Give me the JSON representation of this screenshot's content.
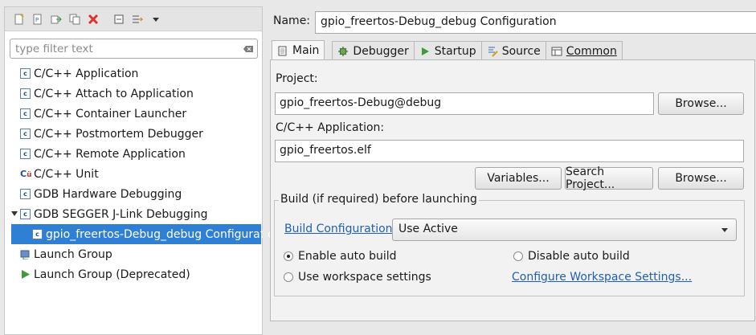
{
  "toolbar": {
    "icons": [
      "new-configuration-icon",
      "new-prototype-icon",
      "export-icon",
      "duplicate-icon",
      "delete-icon",
      "collapse-all-icon",
      "filter-icon",
      "view-menu-icon"
    ]
  },
  "filter": {
    "placeholder": "type filter text",
    "value": ""
  },
  "tree": {
    "items": [
      {
        "label": "C/C++ Application",
        "icon": "c-launch-icon"
      },
      {
        "label": "C/C++ Attach to Application",
        "icon": "c-launch-icon"
      },
      {
        "label": "C/C++ Container Launcher",
        "icon": "c-launch-icon"
      },
      {
        "label": "C/C++ Postmortem Debugger",
        "icon": "c-launch-icon"
      },
      {
        "label": "C/C++ Remote Application",
        "icon": "c-launch-icon"
      },
      {
        "label": "C/C++ Unit",
        "icon": "c-unit-icon"
      },
      {
        "label": "GDB Hardware Debugging",
        "icon": "c-launch-icon"
      },
      {
        "label": "GDB SEGGER J-Link Debugging",
        "icon": "c-launch-icon",
        "expanded": true
      },
      {
        "label": "gpio_freertos-Debug_debug Configuration",
        "icon": "c-launch-icon",
        "selected": true
      },
      {
        "label": "Launch Group",
        "icon": "launch-group-icon"
      },
      {
        "label": "Launch Group (Deprecated)",
        "icon": "run-icon"
      }
    ]
  },
  "config": {
    "name_label": "Name:",
    "name_value": "gpio_freertos-Debug_debug Configuration"
  },
  "tabs": [
    {
      "label": "Main",
      "icon": "main-tab-icon",
      "active": true
    },
    {
      "label": "Debugger",
      "icon": "debugger-tab-icon"
    },
    {
      "label": "Startup",
      "icon": "startup-tab-icon"
    },
    {
      "label": "Source",
      "icon": "source-tab-icon"
    },
    {
      "label": "Common",
      "icon": "common-tab-icon"
    }
  ],
  "main": {
    "project_label": "Project:",
    "project_value": "gpio_freertos-Debug@debug",
    "browse_label": "Browse...",
    "app_label": "C/C++ Application:",
    "app_value": "gpio_freertos.elf",
    "variables_label": "Variables...",
    "search_project_label": "Search Project...",
    "browse2_label": "Browse...",
    "build_group_title": "Build (if required) before launching",
    "build_config_link": "Build Configuration:",
    "build_config_value": "Use Active",
    "enable_auto_build": "Enable auto build",
    "disable_auto_build": "Disable auto build",
    "use_workspace_settings": "Use workspace settings",
    "configure_workspace_link": "Configure Workspace Settings..."
  },
  "colors": {
    "selection": "#2f7fd5",
    "link": "#1f5fb5",
    "delete": "#d9332b"
  }
}
